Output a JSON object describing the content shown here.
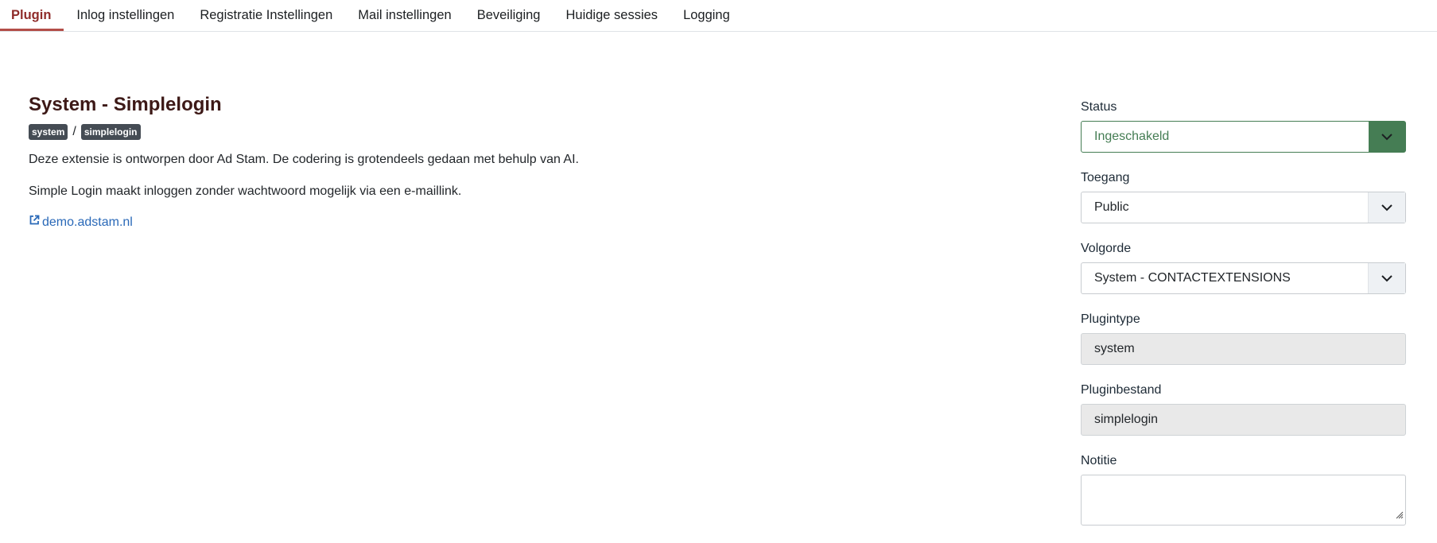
{
  "tabs": [
    {
      "label": "Plugin",
      "active": true
    },
    {
      "label": "Inlog instellingen"
    },
    {
      "label": "Registratie Instellingen"
    },
    {
      "label": "Mail instellingen"
    },
    {
      "label": "Beveiliging"
    },
    {
      "label": "Huidige sessies"
    },
    {
      "label": "Logging"
    }
  ],
  "plugin": {
    "title": "System - Simplelogin",
    "badge_group": "system",
    "badge_element": "simplelogin",
    "separator": "/",
    "description": "Deze extensie is ontworpen door Ad Stam. De codering is grotendeels gedaan met behulp van AI.",
    "summary": "Simple Login maakt inloggen zonder wachtwoord mogelijk via een e-maillink.",
    "link_text": "demo.adstam.nl"
  },
  "fields": {
    "status": {
      "label": "Status",
      "value": "Ingeschakeld"
    },
    "access": {
      "label": "Toegang",
      "value": "Public"
    },
    "ordering": {
      "label": "Volgorde",
      "value": "System - CONTACTEXTENSIONS"
    },
    "plugintype": {
      "label": "Plugintype",
      "value": "system"
    },
    "pluginfile": {
      "label": "Pluginbestand",
      "value": "simplelogin"
    },
    "note": {
      "label": "Notitie",
      "value": ""
    }
  },
  "colors": {
    "active_tab": "#8f2c2a",
    "status_green": "#457d54",
    "link": "#2a69b8",
    "badge": "#454c54"
  },
  "icons": [
    "external-link-icon",
    "chevron-down-icon",
    "resize-handle-icon"
  ]
}
